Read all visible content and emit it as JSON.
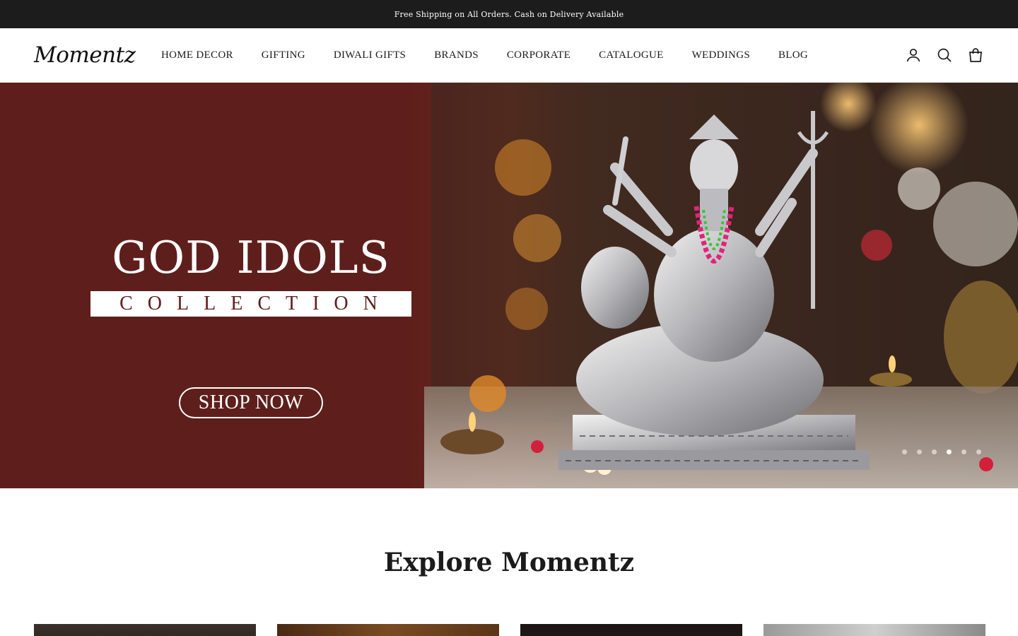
{
  "announcement": {
    "text": "Free Shipping on All Orders. Cash on Delivery Available"
  },
  "header": {
    "logo_text": "Momentz",
    "nav": [
      {
        "label": "HOME DECOR"
      },
      {
        "label": "GIFTING"
      },
      {
        "label": "DIWALI GIFTS"
      },
      {
        "label": "BRANDS"
      },
      {
        "label": "CORPORATE"
      },
      {
        "label": "CATALOGUE"
      },
      {
        "label": "WEDDINGS"
      },
      {
        "label": "BLOG"
      }
    ],
    "icons": [
      "account-icon",
      "search-icon",
      "cart-bag-icon"
    ]
  },
  "hero": {
    "title": "GOD IDOLS",
    "subtitle": "COLLECTION",
    "cta_label": "SHOP NOW",
    "slides_count": 6,
    "active_slide": 4,
    "background_color": "#5e1f1c"
  },
  "explore": {
    "title": "Explore Momentz"
  },
  "colors": {
    "announcement_bg": "#1c1c1c",
    "text": "#1c1b1b",
    "hero_maroon": "#5e1f1c"
  }
}
